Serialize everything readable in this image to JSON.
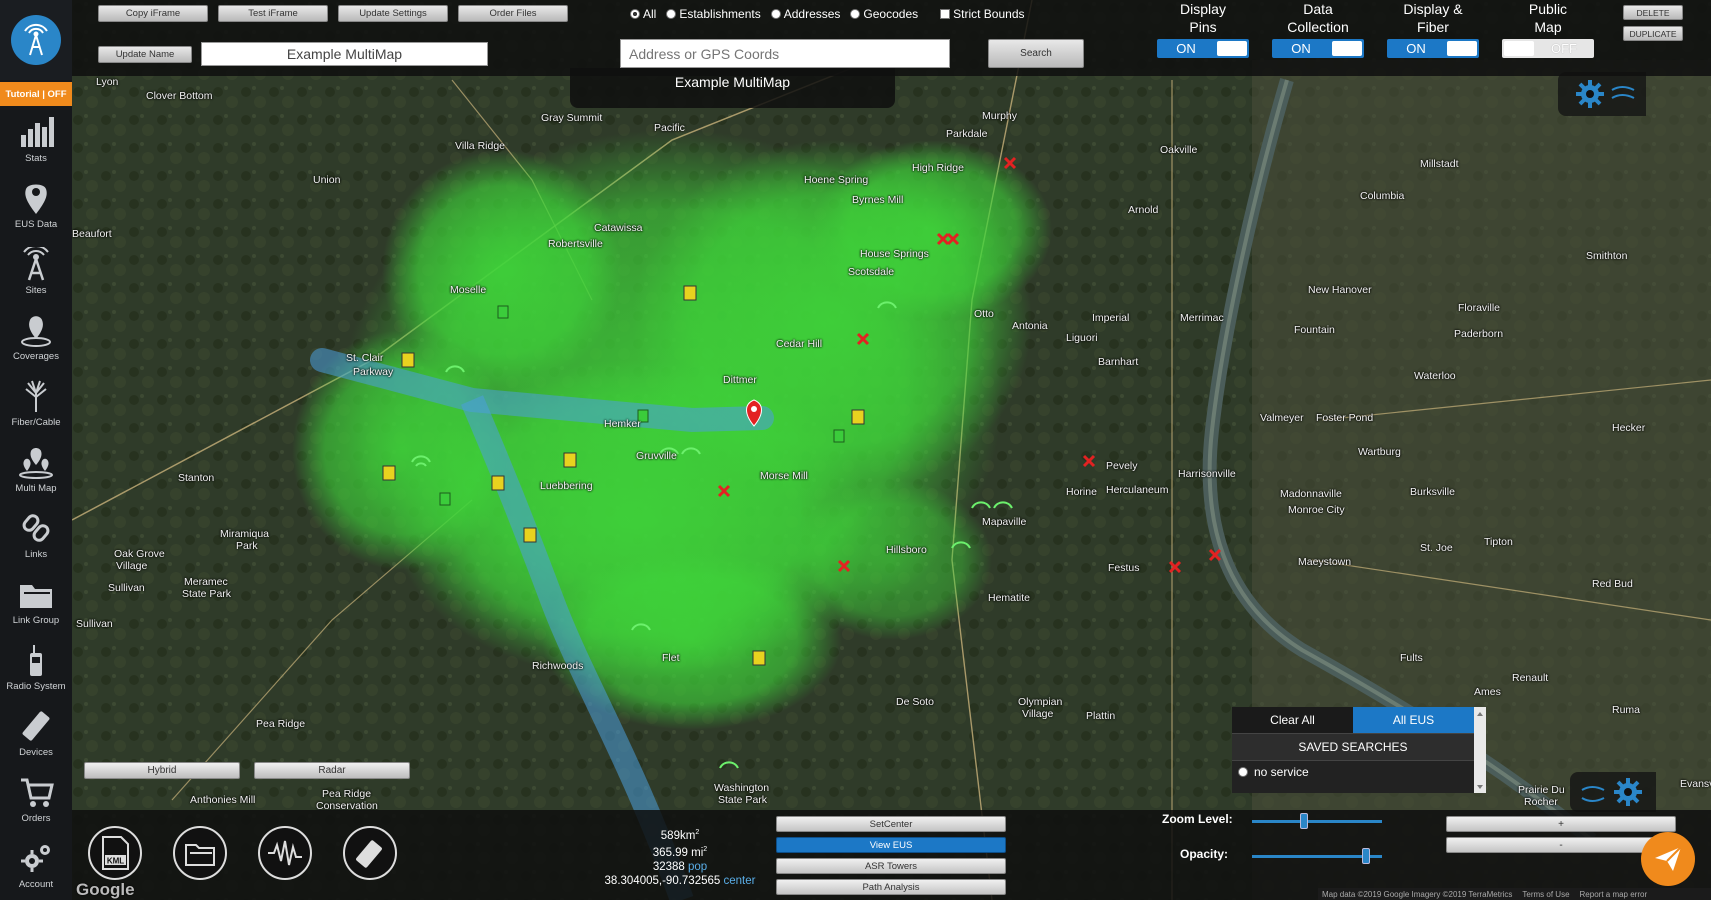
{
  "sidebar": {
    "tutorial": "Tutorial | OFF",
    "items": [
      {
        "label": "Stats",
        "icon": "bar-chart-icon"
      },
      {
        "label": "EUS Data",
        "icon": "map-pin-icon"
      },
      {
        "label": "Sites",
        "icon": "tower-icon"
      },
      {
        "label": "Coverages",
        "icon": "coverage-pin-icon"
      },
      {
        "label": "Fiber/Cable",
        "icon": "fiber-icon"
      },
      {
        "label": "Multi Map",
        "icon": "multi-map-icon"
      },
      {
        "label": "Links",
        "icon": "link-icon"
      },
      {
        "label": "Link Group",
        "icon": "folder-icon"
      },
      {
        "label": "Radio System",
        "icon": "radio-icon"
      },
      {
        "label": "Devices",
        "icon": "device-icon"
      },
      {
        "label": "Orders",
        "icon": "cart-icon"
      },
      {
        "label": "Account",
        "icon": "gear-icon"
      }
    ]
  },
  "toolbar": {
    "copy_iframe": "Copy iFrame",
    "test_iframe": "Test iFrame",
    "update_settings": "Update Settings",
    "order_files": "Order Files",
    "update_name": "Update Name",
    "map_name_value": "Example MultiMap",
    "search_placeholder": "Address or GPS Coords",
    "search_button": "Search",
    "filters": [
      "All",
      "Establishments",
      "Addresses",
      "Geocodes"
    ],
    "strict_bounds": "Strict Bounds",
    "toggles": [
      {
        "label1": "Display",
        "label2": "Pins",
        "state": "ON"
      },
      {
        "label1": "Data",
        "label2": "Collection",
        "state": "ON"
      },
      {
        "label1": "Display &",
        "label2": "Fiber",
        "state": "ON"
      },
      {
        "label1": "Public",
        "label2": "Map",
        "state": "OFF"
      }
    ],
    "delete": "DELETE",
    "duplicate": "DUPLICATE",
    "map_title": "Example MultiMap"
  },
  "map": {
    "towns": [
      [
        "Lyon",
        96,
        82
      ],
      [
        "Clover Bottom",
        146,
        96
      ],
      [
        "Gray Summit",
        541,
        118
      ],
      [
        "Pacific",
        654,
        128
      ],
      [
        "Villa Ridge",
        455,
        146
      ],
      [
        "Murphy",
        982,
        116
      ],
      [
        "Parkdale",
        946,
        134
      ],
      [
        "High Ridge",
        912,
        168
      ],
      [
        "Union",
        313,
        180
      ],
      [
        "Hoene Spring",
        804,
        180
      ],
      [
        "Byrnes Mill",
        852,
        200
      ],
      [
        "Arnold",
        1128,
        210
      ],
      [
        "Oakville",
        1160,
        150
      ],
      [
        "Beaufort",
        72,
        234
      ],
      [
        "Catawissa",
        594,
        228
      ],
      [
        "Robertsville",
        548,
        244
      ],
      [
        "House Springs",
        860,
        254
      ],
      [
        "Scotsdale",
        848,
        272
      ],
      [
        "Columbia",
        1360,
        196
      ],
      [
        "Millstadt",
        1420,
        164
      ],
      [
        "Smithton",
        1586,
        256
      ],
      [
        "Moselle",
        450,
        290
      ],
      [
        "New Hanover",
        1308,
        290
      ],
      [
        "Otto",
        974,
        314
      ],
      [
        "Antonia",
        1012,
        326
      ],
      [
        "Imperial",
        1092,
        318
      ],
      [
        "Merrimac",
        1180,
        318
      ],
      [
        "Fountain",
        1294,
        330
      ],
      [
        "Floraville",
        1458,
        308
      ],
      [
        "Paderborn",
        1454,
        334
      ],
      [
        "Cedar Hill",
        776,
        344
      ],
      [
        "Liguori",
        1066,
        338
      ],
      [
        "Barnhart",
        1098,
        362
      ],
      [
        "St. Clair",
        346,
        358
      ],
      [
        "Parkway",
        353,
        372
      ],
      [
        "Dittmer",
        723,
        380
      ],
      [
        "Waterloo",
        1414,
        376
      ],
      [
        "Valmeyer",
        1260,
        418
      ],
      [
        "Foster Pond",
        1316,
        418
      ],
      [
        "Hemker",
        604,
        424
      ],
      [
        "Hecker",
        1612,
        428
      ],
      [
        "Wartburg",
        1358,
        452
      ],
      [
        "Pevely",
        1106,
        466
      ],
      [
        "Harrisonville",
        1178,
        474
      ],
      [
        "Stanton",
        178,
        478
      ],
      [
        "Gruvville",
        636,
        456
      ],
      [
        "Morse Mill",
        760,
        476
      ],
      [
        "Luebbering",
        540,
        486
      ],
      [
        "Horine",
        1066,
        492
      ],
      [
        "Herculaneum",
        1106,
        490
      ],
      [
        "Madonnaville",
        1280,
        494
      ],
      [
        "Monroe City",
        1288,
        510
      ],
      [
        "Burksville",
        1410,
        492
      ],
      [
        "Mapaville",
        982,
        522
      ],
      [
        "Hillsboro",
        886,
        550
      ],
      [
        "Tipton",
        1484,
        542
      ],
      [
        "Miramiqua",
        220,
        534
      ],
      [
        "Park",
        236,
        546
      ],
      [
        "St. Joe",
        1420,
        548
      ],
      [
        "Festus",
        1108,
        568
      ],
      [
        "Oak Grove",
        114,
        554
      ],
      [
        "Village",
        116,
        566
      ],
      [
        "Maeystown",
        1298,
        562
      ],
      [
        "Meramec",
        184,
        582
      ],
      [
        "State Park",
        182,
        594
      ],
      [
        "Sullivan",
        108,
        588
      ],
      [
        "Red Bud",
        1592,
        584
      ],
      [
        "Hematite",
        988,
        598
      ],
      [
        "Sullivan",
        76,
        624
      ],
      [
        "Richwoods",
        532,
        666
      ],
      [
        "Flet",
        662,
        658
      ],
      [
        "Fults",
        1400,
        658
      ],
      [
        "Renault",
        1512,
        678
      ],
      [
        "De Soto",
        896,
        702
      ],
      [
        "Olympian",
        1018,
        702
      ],
      [
        "Village",
        1022,
        714
      ],
      [
        "Plattin",
        1086,
        716
      ],
      [
        "Ames",
        1474,
        692
      ],
      [
        "Ruma",
        1612,
        710
      ],
      [
        "Pea Ridge",
        256,
        724
      ],
      [
        "Washington",
        714,
        788
      ],
      [
        "State Park",
        718,
        800
      ],
      [
        "Anthonies Mill",
        190,
        800
      ],
      [
        "Pea Ridge",
        322,
        794
      ],
      [
        "Conservation",
        316,
        806
      ],
      [
        "Prairie Du",
        1518,
        790
      ],
      [
        "Rocher",
        1524,
        802
      ],
      [
        "Evansville",
        1680,
        784
      ]
    ],
    "hybrid": "Hybrid",
    "radar": "Radar",
    "google": "Google",
    "attribution": [
      "Map data ©2019 Google Imagery ©2019 TerraMetrics",
      "Terms of Use",
      "Report a map error"
    ]
  },
  "eus_panel": {
    "clear_all": "Clear All",
    "all_eus": "All EUS",
    "saved_searches": "SAVED SEARCHES",
    "item": "no service"
  },
  "bottom": {
    "area_km": "589km",
    "area_mi": "365.99 mi",
    "pop": "32388",
    "pop_label": "pop",
    "coords": "38.304005,-90.732565",
    "coords_label": "center",
    "set_center": "SetCenter",
    "view_eus": "View EUS",
    "asr_towers": "ASR Towers",
    "path_analysis": "Path Analysis",
    "zoom_label": "Zoom Level:",
    "opacity_label": "Opacity:",
    "zoom_in": "+",
    "zoom_out": "-",
    "zoom_value": 0.4,
    "opacity_value": 0.88,
    "kml_label": "KML"
  },
  "colors": {
    "accent": "#1c78c6",
    "orange": "#f08a1c",
    "coverage": "#3fd63a"
  }
}
